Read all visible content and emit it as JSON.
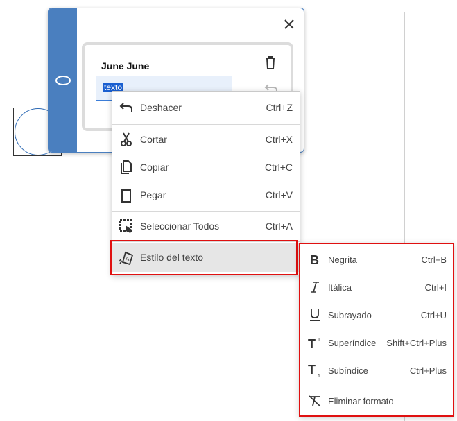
{
  "comment": {
    "author": "June June",
    "selected_text": "texto"
  },
  "context_menu": {
    "items": [
      {
        "label": "Deshacer",
        "shortcut": "Ctrl+Z",
        "icon": "undo-icon"
      },
      {
        "label": "Cortar",
        "shortcut": "Ctrl+X",
        "icon": "scissors-icon"
      },
      {
        "label": "Copiar",
        "shortcut": "Ctrl+C",
        "icon": "copy-icon"
      },
      {
        "label": "Pegar",
        "shortcut": "Ctrl+V",
        "icon": "clipboard-icon"
      },
      {
        "label": "Seleccionar Todos",
        "shortcut": "Ctrl+A",
        "icon": "select-all-icon"
      },
      {
        "label": "Estilo del texto",
        "shortcut": "",
        "icon": "text-style-icon"
      }
    ]
  },
  "text_style_submenu": {
    "items": [
      {
        "label": "Negrita",
        "shortcut": "Ctrl+B",
        "icon": "bold-icon"
      },
      {
        "label": "Itálica",
        "shortcut": "Ctrl+I",
        "icon": "italic-icon"
      },
      {
        "label": "Subrayado",
        "shortcut": "Ctrl+U",
        "icon": "underline-icon"
      },
      {
        "label": "Superíndice",
        "shortcut": "Shift+Ctrl+Plus",
        "icon": "superscript-icon"
      },
      {
        "label": "Subíndice",
        "shortcut": "Ctrl+Plus",
        "icon": "subscript-icon"
      },
      {
        "label": "Eliminar formato",
        "shortcut": "",
        "icon": "clear-format-icon"
      }
    ]
  },
  "colors": {
    "rail": "#4a7fbf",
    "highlight_frame": "#e01010",
    "selection": "#1a5fd0"
  }
}
